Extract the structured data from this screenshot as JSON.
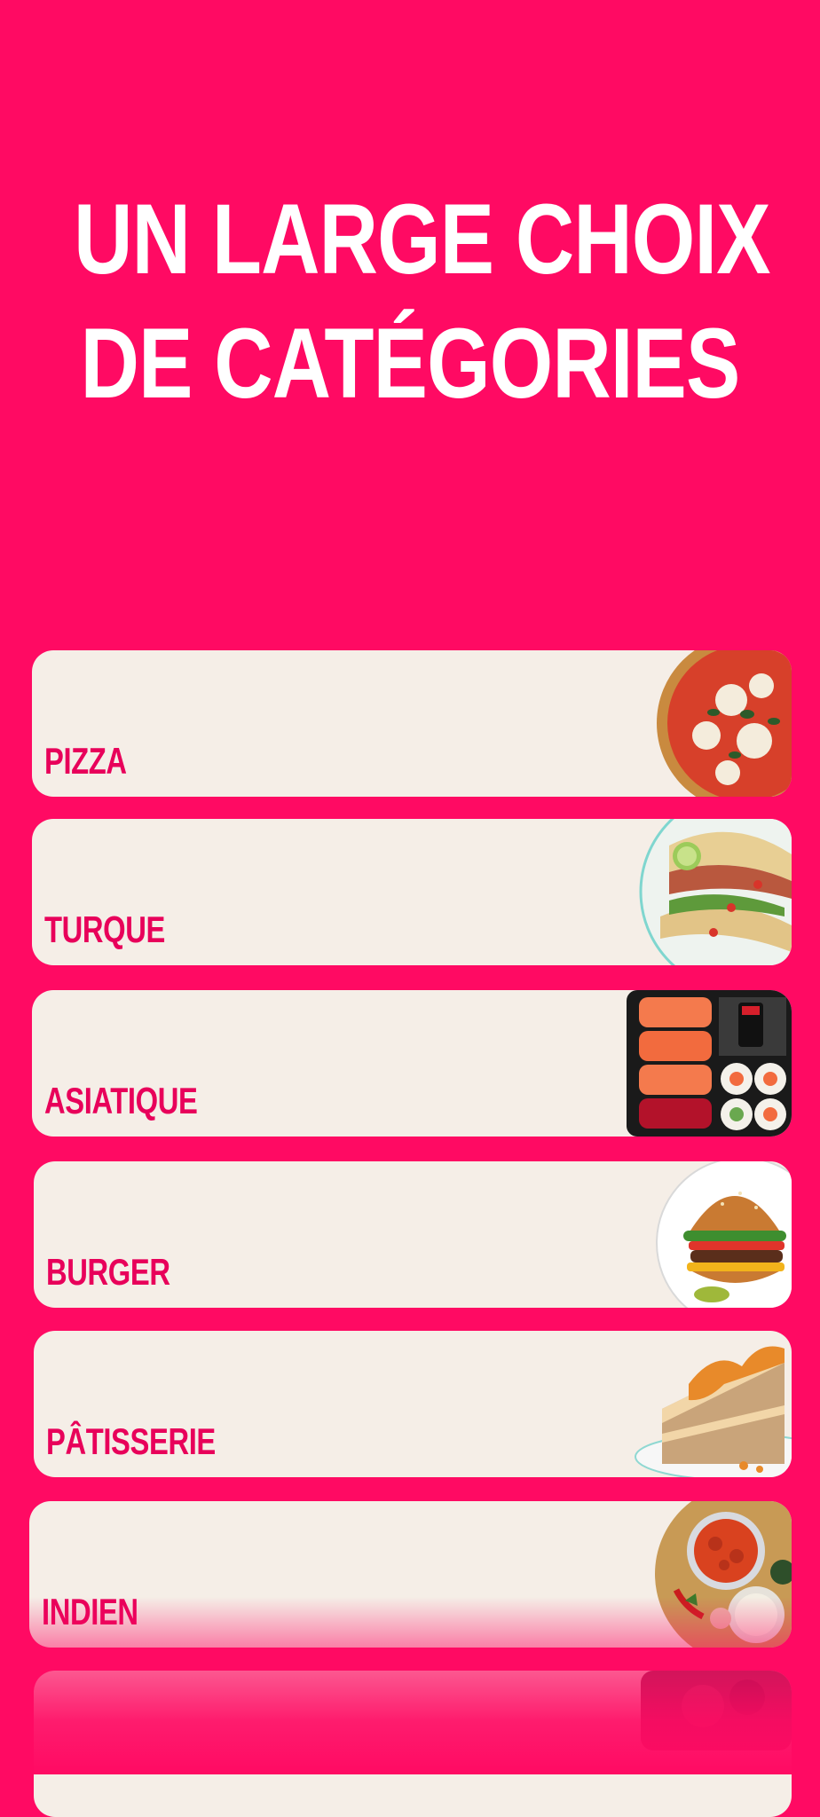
{
  "headline": {
    "line1": "UN LARGE CHOIX",
    "line2": "DE CATÉGORIES"
  },
  "colors": {
    "background": "#ff0a63",
    "card": "#f5eee7",
    "label": "#e8005a",
    "headline": "#ffffff"
  },
  "categories": [
    {
      "label": "PIZZA",
      "image": "pizza-image"
    },
    {
      "label": "TURQUE",
      "image": "tacos-image"
    },
    {
      "label": "ASIATIQUE",
      "image": "sushi-image"
    },
    {
      "label": "BURGER",
      "image": "burger-image"
    },
    {
      "label": "PÂTISSERIE",
      "image": "cake-image"
    },
    {
      "label": "INDIEN",
      "image": "curry-image"
    }
  ]
}
